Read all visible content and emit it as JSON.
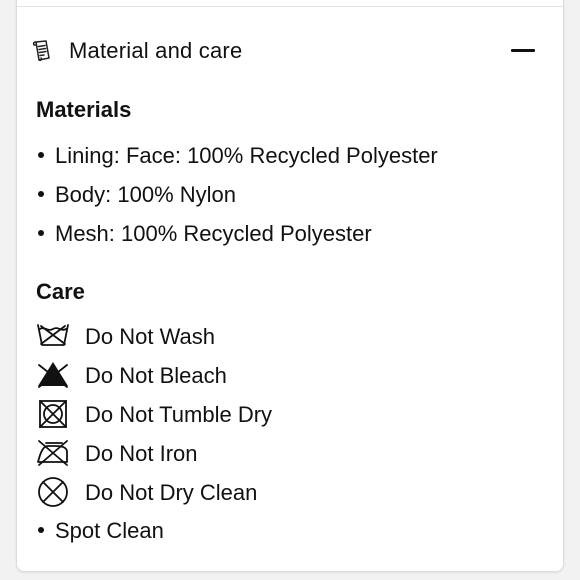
{
  "accordion": {
    "title": "Material and care",
    "header_icon": "document-icon",
    "toggle_icon": "minus-icon"
  },
  "materials": {
    "heading": "Materials",
    "items": [
      "Lining: Face: 100% Recycled Polyester",
      "Body: 100% Nylon",
      "Mesh: 100% Recycled Polyester"
    ]
  },
  "care": {
    "heading": "Care",
    "items": [
      {
        "label": "Do Not Wash",
        "icon": "do-not-wash-icon"
      },
      {
        "label": "Do Not Bleach",
        "icon": "do-not-bleach-icon"
      },
      {
        "label": "Do Not Tumble Dry",
        "icon": "do-not-tumble-dry-icon"
      },
      {
        "label": "Do Not Iron",
        "icon": "do-not-iron-icon"
      },
      {
        "label": "Do Not Dry Clean",
        "icon": "do-not-dry-clean-icon"
      }
    ],
    "extra": "Spot Clean"
  }
}
